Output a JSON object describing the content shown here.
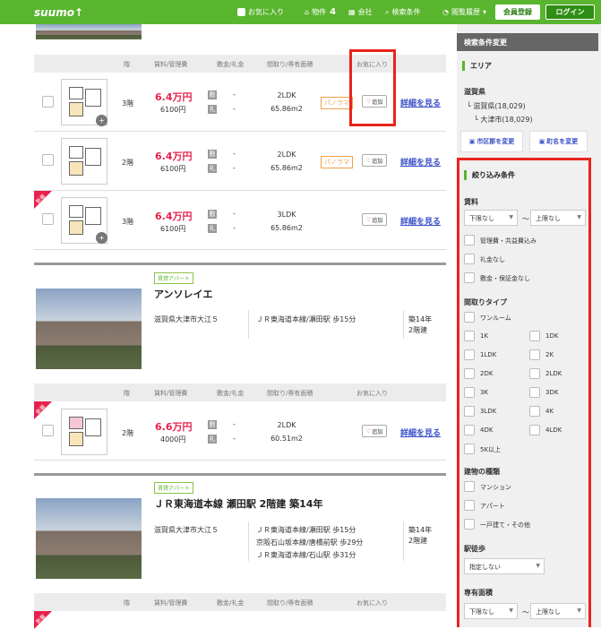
{
  "header": {
    "logo": "suumo↑",
    "fav": "お気に入り",
    "bukken": "物件",
    "bukken_count": "4",
    "company": "会社",
    "search_cond": "検索条件",
    "history": "閲覧履歴",
    "register": "会員登録",
    "login": "ログイン"
  },
  "colors": {
    "green": "#5ab52e",
    "red": "#e8214b",
    "link": "#3a50c8"
  },
  "table_header": {
    "floor": "階",
    "rent": "賃料/管理費",
    "deposit": "敷金/礼金",
    "layout": "間取り/専有面積",
    "fav": "お気に入り"
  },
  "rows1": [
    {
      "floor": "3階",
      "rent": "6.4万円",
      "mgmt": "6100円",
      "layout": "2LDK",
      "area": "65.86m2",
      "pano": "パノラマ",
      "add": "追加",
      "detail": "詳細を見る",
      "new": false
    },
    {
      "floor": "2階",
      "rent": "6.4万円",
      "mgmt": "6100円",
      "layout": "2LDK",
      "area": "65.86m2",
      "pano": "パノラマ",
      "add": "追加",
      "detail": "詳細を見る",
      "new": false
    },
    {
      "floor": "3階",
      "rent": "6.4万円",
      "mgmt": "6100円",
      "layout": "3LDK",
      "area": "65.86m2",
      "pano": "",
      "add": "追加",
      "detail": "詳細を見る",
      "new": true
    }
  ],
  "tags": {
    "shiki": "敷",
    "rei": "礼",
    "dash": "-",
    "new": "新着"
  },
  "building2": {
    "type": "賃貸アパート",
    "name": "アンソレイエ",
    "address": "滋賀県大津市大江５",
    "access": [
      "ＪＲ東海道本線/瀬田駅 歩15分"
    ],
    "age": "築14年",
    "stories": "2階建"
  },
  "row2": {
    "floor": "2階",
    "rent": "6.6万円",
    "mgmt": "4000円",
    "layout": "2LDK",
    "area": "60.51m2",
    "add": "追加",
    "detail": "詳細を見る"
  },
  "building3": {
    "type": "賃貸アパート",
    "name": "ＪＲ東海道本線 瀬田駅 2階建 築14年",
    "address": "滋賀県大津市大江５",
    "access": [
      "ＪＲ東海道本線/瀬田駅 歩15分",
      "京阪石山坂本線/唐橋前駅 歩29分",
      "ＪＲ東海道本線/石山駅 歩31分"
    ],
    "age": "築14年",
    "stories": "2階建"
  },
  "sidebar": {
    "title": "検索条件変更",
    "area_title": "エリア",
    "pref": "滋賀県",
    "tree1": "滋賀県(18,029)",
    "tree2": "大津市(18,029)",
    "btn_city": "市区郡を変更",
    "btn_town": "町名を変更",
    "filter_title": "絞り込み条件",
    "rent_label": "賃料",
    "rent_min": "下限なし",
    "rent_max": "上限なし",
    "tilde": "～",
    "rent_opts": [
      "管理費・共益費込み",
      "礼金なし",
      "敷金・保証金なし"
    ],
    "layout_label": "間取りタイプ",
    "layouts": [
      "ワンルーム",
      "1K",
      "1DK",
      "1LDK",
      "2K",
      "2DK",
      "2LDK",
      "3K",
      "3DK",
      "3LDK",
      "4K",
      "4DK",
      "4LDK",
      "5K以上"
    ],
    "bldg_label": "建物の種類",
    "bldg_opts": [
      "マンション",
      "アパート",
      "一戸建て・その他"
    ],
    "walk_label": "駅徒歩",
    "walk_val": "指定しない",
    "area_label": "専有面積",
    "area_min": "下限なし",
    "area_max": "上限なし"
  }
}
